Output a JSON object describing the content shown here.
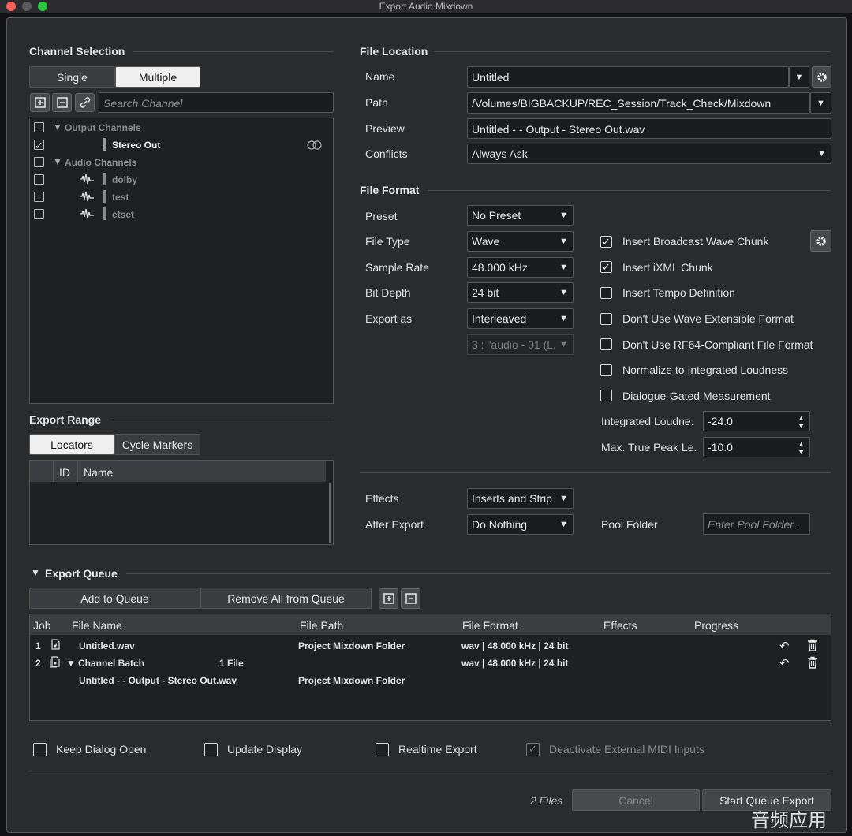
{
  "window": {
    "title": "Export Audio Mixdown"
  },
  "channel_selection": {
    "heading": "Channel Selection",
    "modes": [
      "Single",
      "Multiple"
    ],
    "search_placeholder": "Search Channel",
    "groups": [
      {
        "label": "Output Channels",
        "checked": false
      },
      {
        "label": "Audio Channels",
        "checked": false
      }
    ],
    "items": [
      {
        "label": "Stereo Out",
        "checked": true
      },
      {
        "label": "dolby",
        "checked": false
      },
      {
        "label": "test",
        "checked": false
      },
      {
        "label": "etset",
        "checked": false
      }
    ]
  },
  "export_range": {
    "heading": "Export Range",
    "tabs": [
      "Locators",
      "Cycle Markers"
    ],
    "columns": [
      "ID",
      "Name"
    ]
  },
  "file_location": {
    "heading": "File Location",
    "name_label": "Name",
    "name_value": "Untitled",
    "path_label": "Path",
    "path_value": "/Volumes/BIGBACKUP/REC_Session/Track_Check/Mixdown",
    "preview_label": "Preview",
    "preview_value": "Untitled -  - Output - Stereo Out.wav",
    "conflicts_label": "Conflicts",
    "conflicts_value": "Always Ask"
  },
  "file_format": {
    "heading": "File Format",
    "preset_label": "Preset",
    "preset_value": "No Preset",
    "filetype_label": "File Type",
    "filetype_value": "Wave",
    "samplerate_label": "Sample Rate",
    "samplerate_value": "48.000 kHz",
    "bitdepth_label": "Bit Depth",
    "bitdepth_value": "24 bit",
    "exportas_label": "Export as",
    "exportas_value": "Interleaved",
    "channel_value": "3 : \"audio - 01 (L.",
    "options": [
      {
        "label": "Insert Broadcast Wave Chunk",
        "checked": true
      },
      {
        "label": "Insert iXML Chunk",
        "checked": true
      },
      {
        "label": "Insert Tempo Definition",
        "checked": false
      },
      {
        "label": "Don't Use Wave Extensible Format",
        "checked": false
      },
      {
        "label": "Don't Use RF64-Compliant File Format",
        "checked": false
      },
      {
        "label": "Normalize to Integrated Loudness",
        "checked": false
      },
      {
        "label": "Dialogue-Gated Measurement",
        "checked": false
      }
    ],
    "loudness_label": "Integrated Loudne.",
    "loudness_value": "-24.0",
    "truepeak_label": "Max. True Peak Le.",
    "truepeak_value": "-10.0"
  },
  "post": {
    "effects_label": "Effects",
    "effects_value": "Inserts and Strip",
    "after_label": "After Export",
    "after_value": "Do Nothing",
    "pool_label": "Pool Folder",
    "pool_placeholder": "Enter Pool Folder ."
  },
  "queue": {
    "heading": "Export Queue",
    "add_label": "Add to Queue",
    "remove_label": "Remove All from Queue",
    "columns": {
      "job": "Job",
      "file_name": "File Name",
      "file_path": "File Path",
      "file_format": "File Format",
      "effects": "Effects",
      "progress": "Progress"
    },
    "rows": [
      {
        "job": "1",
        "name": "Untitled.wav",
        "count": "",
        "path": "Project Mixdown Folder",
        "format": "wav | 48.000 kHz | 24 bit"
      },
      {
        "job": "2",
        "name": "Channel Batch",
        "count": "1 File",
        "path": "",
        "format": "wav | 48.000 kHz | 24 bit"
      }
    ],
    "subrow": {
      "name": "Untitled -  - Output - Stereo Out.wav",
      "path": "Project Mixdown Folder"
    }
  },
  "footer": {
    "keep_open": "Keep Dialog Open",
    "update_display": "Update Display",
    "realtime": "Realtime Export",
    "deactivate_midi": "Deactivate External MIDI Inputs",
    "files_count": "2 Files",
    "cancel": "Cancel",
    "start": "Start Queue Export"
  },
  "watermark": "音频应用"
}
